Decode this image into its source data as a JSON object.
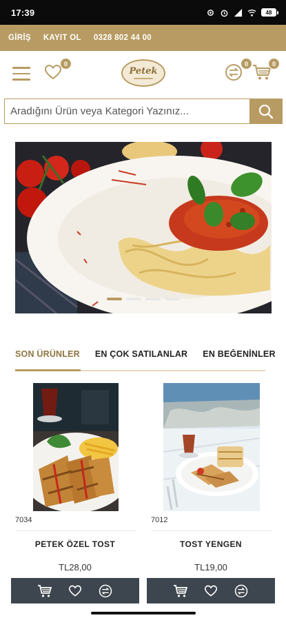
{
  "status": {
    "time": "17:39",
    "battery": "48"
  },
  "topbar": {
    "login": "GİRİŞ",
    "register": "KAYIT OL",
    "phone": "0328 802 44 00"
  },
  "header": {
    "wishlist_count": "0",
    "compare_count": "0",
    "cart_count": "0",
    "logo_text": "Petek"
  },
  "search": {
    "placeholder": "Aradığını Ürün veya Kategori Yazınız..."
  },
  "tabs": [
    {
      "label": "SON ÜRÜNLER"
    },
    {
      "label": "EN ÇOK SATILANLAR"
    },
    {
      "label": "EN BEĞENİNLER"
    }
  ],
  "products": [
    {
      "code": "7034",
      "name": "PETEK ÖZEL TOST",
      "price": "TL28,00"
    },
    {
      "code": "7012",
      "name": "TOST YENGEN",
      "price": "TL19,00"
    }
  ],
  "colors": {
    "gold": "#b79b62",
    "dark": "#3d464e"
  }
}
